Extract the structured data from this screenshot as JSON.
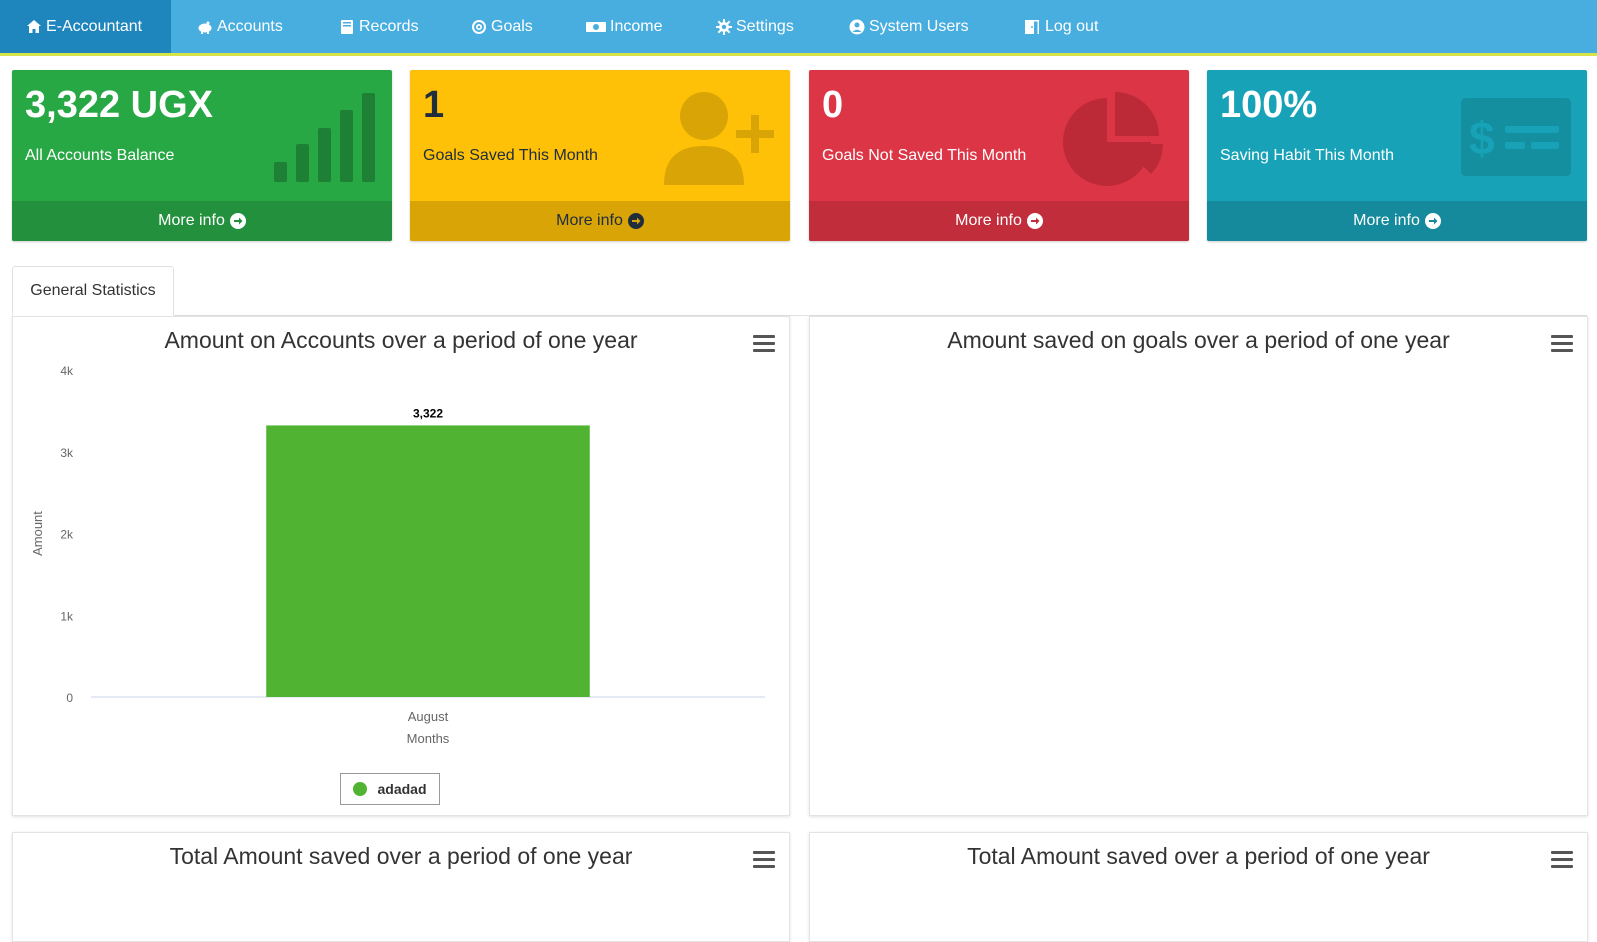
{
  "nav": {
    "brand": "E-Accountant",
    "items": [
      {
        "label": "Accounts",
        "icon": "piggy-bank-icon"
      },
      {
        "label": "Records",
        "icon": "book-icon"
      },
      {
        "label": "Goals",
        "icon": "target-icon"
      },
      {
        "label": "Income",
        "icon": "money-bill-icon"
      },
      {
        "label": "Settings",
        "icon": "gear-icon"
      },
      {
        "label": "System Users",
        "icon": "user-circle-icon"
      },
      {
        "label": "Log out",
        "icon": "door-open-icon"
      }
    ]
  },
  "stats": [
    {
      "value": "3,322 UGX",
      "label": "All Accounts Balance",
      "footer": "More info",
      "color": "#28a745",
      "icon": "signal-bars-icon"
    },
    {
      "value": "1",
      "label": "Goals Saved This Month",
      "footer": "More info",
      "color": "#ffc107",
      "icon": "user-plus-icon"
    },
    {
      "value": "0",
      "label": "Goals Not Saved This Month",
      "footer": "More info",
      "color": "#dc3545",
      "icon": "pie-chart-icon"
    },
    {
      "value": "100%",
      "label": "Saving Habit This Month",
      "footer": "More info",
      "color": "#17a2b8",
      "icon": "money-check-icon"
    }
  ],
  "tab": {
    "label": "General Statistics"
  },
  "panels": [
    {
      "title": "Amount on Accounts over a period of one year"
    },
    {
      "title": "Amount saved on goals over a period of one year"
    },
    {
      "title": "Total Amount saved over a period of one year"
    },
    {
      "title": "Total Amount saved over a period of one year"
    }
  ],
  "chart_data": {
    "type": "bar",
    "title": "Amount on Accounts over a period of one year",
    "xlabel": "Months",
    "ylabel": "Amount",
    "categories": [
      "August"
    ],
    "series": [
      {
        "name": "adadad",
        "values": [
          3322
        ],
        "color": "#50b432"
      }
    ],
    "data_labels": [
      "3,322"
    ],
    "yticks": [
      "0",
      "1k",
      "2k",
      "3k",
      "4k"
    ],
    "ylim": [
      0,
      4000
    ],
    "legend": "bottom-center"
  }
}
